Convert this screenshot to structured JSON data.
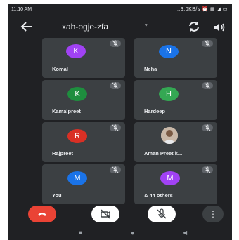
{
  "status_bar": {
    "time": "11:10 AM",
    "icons_text": "...3.0KB/s ⏰ ▦ ◢ ▭"
  },
  "header": {
    "meeting_code": "xah-ogje-zfa",
    "dropdown_glyph": "▾"
  },
  "participants": [
    {
      "name": "Komal",
      "initial": "K",
      "color": "#a142f4",
      "muted": true
    },
    {
      "name": "Neha",
      "initial": "N",
      "color": "#1a73e8",
      "muted": true
    },
    {
      "name": "Kamalpreet",
      "initial": "K",
      "color": "#1e8e3e",
      "muted": true
    },
    {
      "name": "Hardeep",
      "initial": "H",
      "color": "#34a853",
      "muted": true
    },
    {
      "name": "Rajpreet",
      "initial": "R",
      "color": "#d93025",
      "muted": true
    },
    {
      "name": "Aman Preet k...",
      "initial": "",
      "color": "#9aa0a6",
      "muted": true,
      "has_photo": true
    },
    {
      "name": "You",
      "initial": "M",
      "color": "#1a73e8",
      "muted": true
    },
    {
      "name": "& 44 others",
      "initial": "M",
      "color": "#a142f4",
      "muted": true
    }
  ],
  "controls": {
    "end_call_color": "#ea4335",
    "camera_state": "off",
    "mic_state": "off",
    "more_glyph": "⋮"
  },
  "nav": {
    "back": "■",
    "home": "●",
    "recents": "◀"
  }
}
